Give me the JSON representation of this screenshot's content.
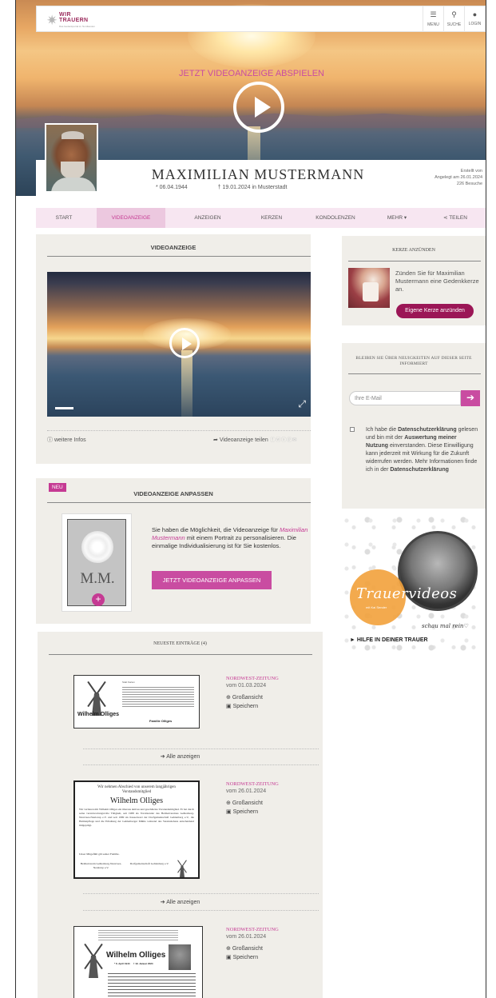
{
  "header": {
    "logo_line1": "WIR",
    "logo_line2": "TRAUERN",
    "logo_tagline": "Das Gedenkportal im Nordwesten",
    "menu_label": "MENU",
    "search_label": "SUCHE",
    "login_label": "LOGIN"
  },
  "hero": {
    "play_link": "JETZT VIDEOANZEIGE ABSPIELEN"
  },
  "person": {
    "first_name": "MAXIMILIAN",
    "last_name": "MUSTERMANN",
    "born": "* 06.04.1944",
    "died": "† 19.01.2024 in Musterstadt",
    "created_label": "Erstellt von",
    "created_on": "Angelegt am 26.01.2024",
    "visits": "226 Besuche"
  },
  "tabs": [
    {
      "label": "START"
    },
    {
      "label": "VIDEOANZEIGE"
    },
    {
      "label": "ANZEIGEN"
    },
    {
      "label": "KERZEN"
    },
    {
      "label": "KONDOLENZEN"
    },
    {
      "label": "MEHR ▾"
    },
    {
      "label": "TEILEN"
    }
  ],
  "video_section": {
    "title": "VIDEOANZEIGE",
    "info_link": "weitere Infos",
    "share_link": "Videoanzeige teilen",
    "progress": 0.07
  },
  "customize_section": {
    "badge": "NEU",
    "title": "VIDEOANZEIGE ANPASSEN",
    "initials": "M.M.",
    "text_pre": "Sie haben die Möglichkeit, die Videoanzeige für ",
    "text_name": "Maximilian Mustermann",
    "text_post": " mit einem Portrait zu personalisieren. Die einmalige Individualisierung ist für Sie kostenlos.",
    "button": "JETZT VIDEOANZEIGE ANPASSEN"
  },
  "candle_section": {
    "title": "KERZE ANZÜNDEN",
    "text": "Zünden Sie für Maximilian Mustermann eine Gedenkkerze an.",
    "button": "Eigene Kerze anzünden"
  },
  "newsletter_section": {
    "title": "BLEIBEN SIE ÜBER NEUIGKEITEN AUF DIESER SEITE INFORMIERT",
    "email_placeholder": "Ihre E-Mail",
    "consent_1": "Ich habe die ",
    "consent_b1": "Datenschutzerklärung",
    "consent_2": " gelesen und bin mit der ",
    "consent_b2": "Auswertung meiner Nutzung",
    "consent_3": " einverstanden. Diese Einwilligung kann jederzeit mit Wirkung für die Zukunft widerrufen werden. Mehr Informationen finde ich in der ",
    "consent_b3": "Datenschutzerklärung"
  },
  "ad": {
    "script_title": "Trauervideos",
    "sub": "mit Kai Sender",
    "schau": "schau mal rein",
    "help": "► HILFE IN DEINER TRAUER"
  },
  "entries_section": {
    "title": "NEUESTE EINTRÄGE (4)",
    "all_label": "Alle anzeigen",
    "entries": [
      {
        "paper": "NORDWEST-ZEITUNG",
        "date": "vom 01.03.2024",
        "view": "Großansicht",
        "save": "Speichern",
        "name": "Wilhelm Olliges",
        "footer": "Familie Olliges",
        "heading": "Statt Karten"
      },
      {
        "paper": "NORDWEST-ZEITUNG",
        "date": "vom 26.01.2024",
        "view": "Großansicht",
        "save": "Speichern",
        "heading": "Wir nehmen Abschied von unserem langjährigen Vorstandsmitglied",
        "name": "Wilhelm Olliges",
        "body": "Wir verlieren mit Wilhelm Olliges ein überaus aktives und geschätztes Vorstandsmitglied. Er hat durch seine verantwortungsvolle Tätigkeit, seit 1988 als Vorsitzender des Heimatvereines Gehlenberg-Neuvrees-Neulorup e.V. und seit 1989 als Kassenwart der Dorfgemeinschaft Gehlenberg e.V., die Heimatpflege und die Erhaltung der Gehlenberger Mühle wahrend des Vereinslebens entscheidend mitgeprägt.",
        "closing": "Unser Mitgefühl gilt seiner Familie.",
        "sig1": "Heimatverein Gehlenberg-Neuvrees-Neulorup e.V.",
        "sig2": "Dorfgemeinschaft Gehlenberg e.V."
      },
      {
        "paper": "NORDWEST-ZEITUNG",
        "date": "vom 26.01.2024",
        "view": "Großansicht",
        "save": "Speichern",
        "name": "Wilhelm Olliges",
        "dates": "* 6. April 1944     † 19. Januar 2024"
      }
    ]
  },
  "colors": {
    "accent": "#c94ca1",
    "accent_dark": "#9b1656",
    "tab_bg": "#f7e6f1",
    "section_bg": "#f0eee9"
  }
}
